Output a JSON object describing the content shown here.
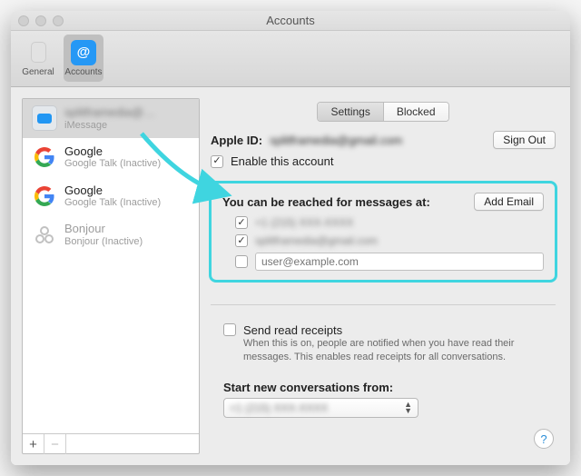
{
  "window": {
    "title": "Accounts"
  },
  "toolbar": {
    "items": [
      {
        "label": "General"
      },
      {
        "label": "Accounts"
      }
    ]
  },
  "sidebar": {
    "accounts": [
      {
        "name_blurred": "splitframedia@…",
        "sub": "iMessage"
      },
      {
        "name": "Google",
        "sub": "Google Talk (Inactive)"
      },
      {
        "name": "Google",
        "sub": "Google Talk (Inactive)"
      },
      {
        "name": "Bonjour",
        "sub": "Bonjour (Inactive)"
      }
    ],
    "add_label": "+",
    "remove_label": "−"
  },
  "tabs": {
    "settings": "Settings",
    "blocked": "Blocked"
  },
  "main": {
    "apple_id_label": "Apple ID:",
    "apple_id_value_blurred": "splitframedia@gmail.com",
    "sign_out": "Sign Out",
    "enable": "Enable this account",
    "reach_heading": "You can be reached for messages at:",
    "add_email": "Add Email",
    "reach_items": [
      {
        "checked": true,
        "text_blurred": "+1 (215) XXX-XXXX"
      },
      {
        "checked": true,
        "text_blurred": "splitframedia@gmail.com"
      }
    ],
    "email_placeholder": "user@example.com",
    "read_receipts_label": "Send read receipts",
    "read_receipts_desc": "When this is on, people are notified when you have read their messages. This enables read receipts for all conversations.",
    "start_new_label": "Start new conversations from:",
    "start_new_value_blurred": "+1 (215) XXX-XXXX",
    "help": "?"
  }
}
